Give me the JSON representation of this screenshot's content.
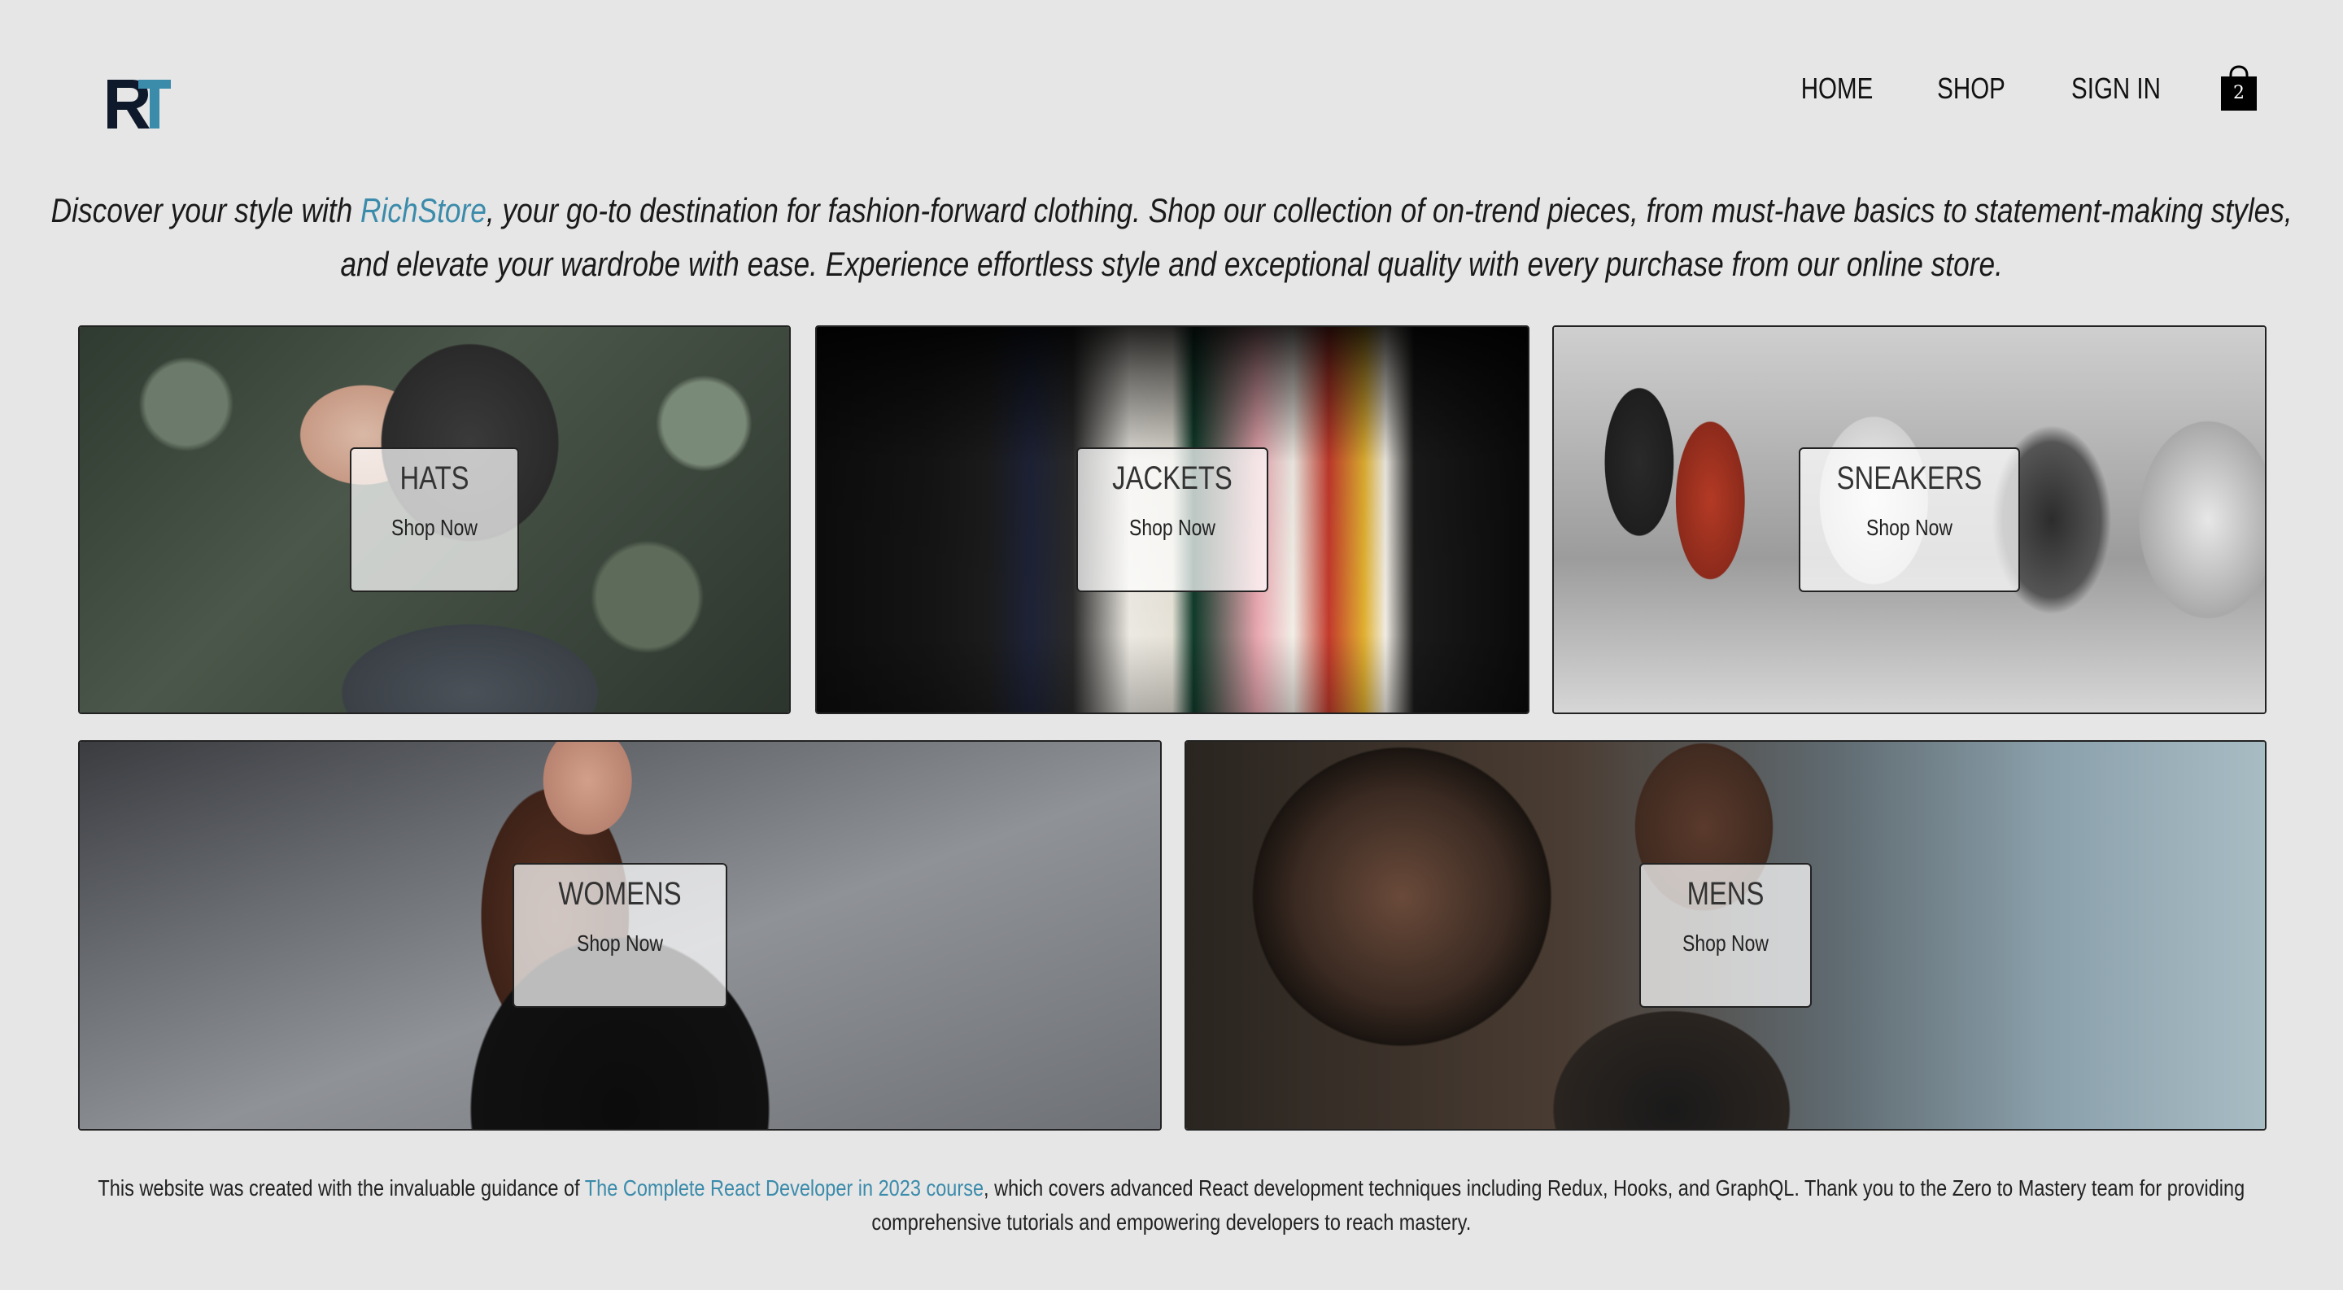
{
  "header": {
    "logo_text": "RT",
    "nav": [
      {
        "label": "HOME"
      },
      {
        "label": "SHOP"
      },
      {
        "label": "SIGN IN"
      }
    ],
    "cart_count": "2"
  },
  "tagline": {
    "prefix": "Discover your style with ",
    "brand": "RichStore",
    "suffix": ", your go-to destination for fashion-forward clothing. Shop our collection of on-trend pieces, from must-have basics to statement-making styles, and elevate your wardrobe with ease. Experience effortless style and exceptional quality with every purchase from our online store."
  },
  "categories": [
    {
      "title": "HATS",
      "cta": "Shop Now"
    },
    {
      "title": "JACKETS",
      "cta": "Shop Now"
    },
    {
      "title": "SNEAKERS",
      "cta": "Shop Now"
    },
    {
      "title": "WOMENS",
      "cta": "Shop Now"
    },
    {
      "title": "MENS",
      "cta": "Shop Now"
    }
  ],
  "footer": {
    "prefix": "This website was created with the invaluable guidance of ",
    "link": "The Complete React Developer in 2023 course",
    "suffix": ", which covers advanced React development techniques including Redux, Hooks, and GraphQL. Thank you to the Zero to Mastery team for providing comprehensive tutorials and empowering developers to reach mastery."
  },
  "colors": {
    "background": "#e6e6e6",
    "accent": "#3b8bab",
    "text": "#111111"
  }
}
